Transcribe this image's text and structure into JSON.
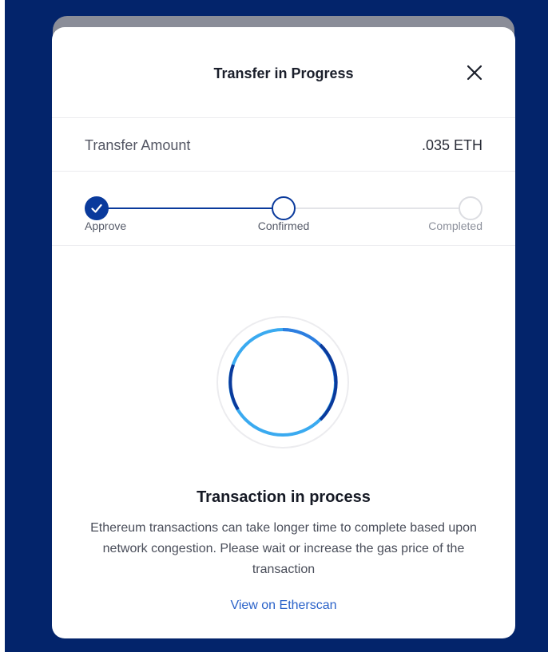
{
  "modal": {
    "title": "Transfer in Progress",
    "close_icon": "close-icon"
  },
  "transfer": {
    "label": "Transfer Amount",
    "value": ".035 ETH"
  },
  "steps": [
    {
      "label": "Approve",
      "state": "done"
    },
    {
      "label": "Confirmed",
      "state": "active"
    },
    {
      "label": "Completed",
      "state": "pending"
    }
  ],
  "status": {
    "title": "Transaction in process",
    "description": "Ethereum transactions can take longer time to complete based upon network congestion. Please wait or increase the gas price of the transaction",
    "link": "View on Etherscan"
  },
  "colors": {
    "backdrop": "#03246b",
    "accent": "#0a3a9c",
    "link": "#2a62c9",
    "spinner_light": "#35a9ee",
    "spinner_dark": "#0a3a9c"
  }
}
